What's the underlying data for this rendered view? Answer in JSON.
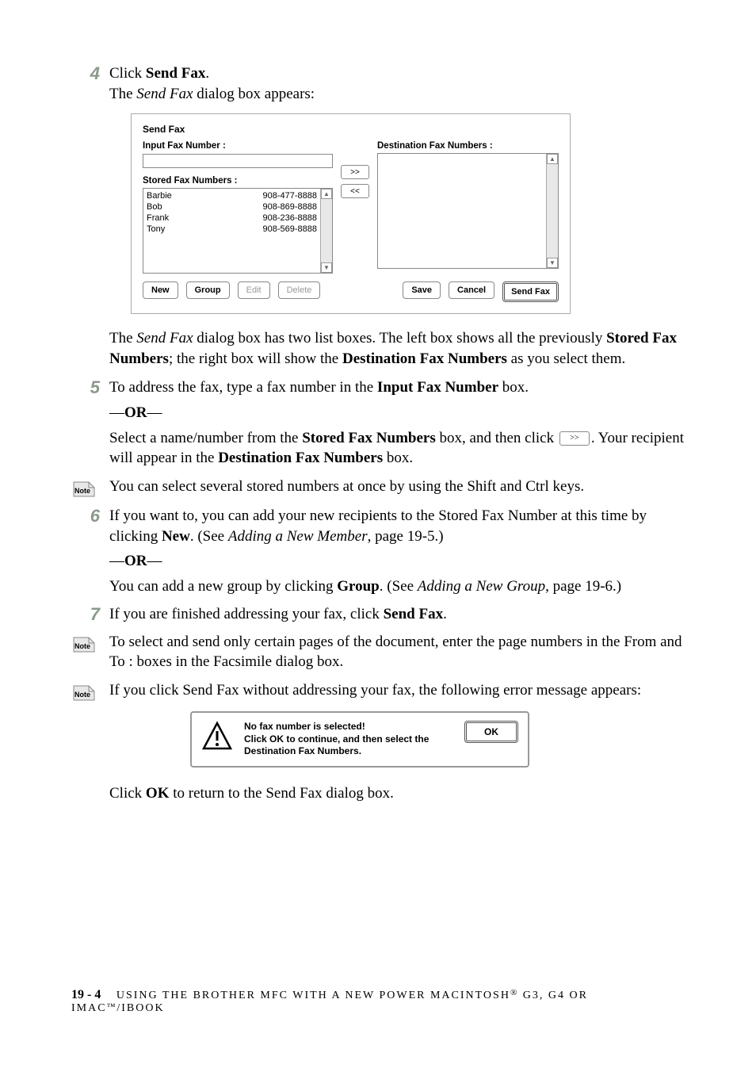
{
  "steps": {
    "s4": {
      "num": "4",
      "line1_pre": "Click ",
      "line1_bold": "Send Fax",
      "line1_post": ".",
      "line2_pre": "The ",
      "line2_it": "Send Fax",
      "line2_post": " dialog box appears:"
    },
    "p_after_dialog": {
      "t1": "The ",
      "t2": "Send Fax",
      "t3": " dialog box has two list boxes. The left box shows all the previously ",
      "t4": "Stored Fax Numbers",
      "t5": "; the right box will show the ",
      "t6": "Destination Fax Numbers",
      "t7": " as you select them."
    },
    "s5": {
      "num": "5",
      "l1a": "To address the fax, type a fax number in the ",
      "l1b": "Input Fax Number",
      "l1c": " box.",
      "or": "—OR—",
      "l2a": "Select a name/number from the ",
      "l2b": "Stored Fax Numbers",
      "l2c": " box, and then click ",
      "l2d": ". Your recipient will appear in the ",
      "l2e": "Destination Fax Numbers",
      "l2f": " box."
    },
    "note1": "You can select several stored numbers at once by using the Shift and Ctrl keys.",
    "s6": {
      "num": "6",
      "l1a": "If you want to, you can add your new recipients to the Stored Fax Number at this time by clicking ",
      "l1b": "New",
      "l1c": ". (See ",
      "l1d": "Adding a New Member",
      "l1e": ", page 19-5.)",
      "or": "—OR—",
      "l2a": "You can add a new group by clicking ",
      "l2b": "Group",
      "l2c": ". (See ",
      "l2d": "Adding a New Group",
      "l2e": ", page 19-6.)"
    },
    "s7": {
      "num": "7",
      "l1a": "If you are finished addressing your fax, click ",
      "l1b": "Send Fax",
      "l1c": "."
    },
    "note2": "To select and send only certain pages of the document, enter the page numbers in the From and To : boxes in the Facsimile dialog box.",
    "note3": "If you click Send Fax without addressing your fax, the following error message appears:",
    "after_error_a": "Click ",
    "after_error_b": "OK",
    "after_error_c": " to return to the Send Fax dialog box."
  },
  "dialog": {
    "title": "Send Fax",
    "input_label": "Input Fax Number :",
    "stored_label": "Stored Fax Numbers :",
    "dest_label": "Destination Fax Numbers :",
    "btn_add": ">>",
    "btn_remove": "<<",
    "stored": [
      {
        "name": "Barbie",
        "num": "908-477-8888"
      },
      {
        "name": "Bob",
        "num": "908-869-8888"
      },
      {
        "name": "Frank",
        "num": "908-236-8888"
      },
      {
        "name": "Tony",
        "num": "908-569-8888"
      }
    ],
    "buttons": {
      "new": "New",
      "group": "Group",
      "edit": "Edit",
      "delete": "Delete",
      "save": "Save",
      "cancel": "Cancel",
      "sendfax": "Send Fax"
    }
  },
  "error_dialog": {
    "l1": "No fax number is selected!",
    "l2": "Click OK to continue, and then select the",
    "l3": "Destination Fax Numbers.",
    "ok": "OK"
  },
  "note_label": "Note",
  "inline_add_icon": ">>",
  "footer": {
    "page": "19 - 4",
    "text_a": "USING THE BROTHER MFC WITH A NEW POWER MACINTOSH",
    "reg": "®",
    "text_b": " G3, G4 OR IMAC",
    "tm": "™",
    "text_c": "/IBOOK"
  }
}
